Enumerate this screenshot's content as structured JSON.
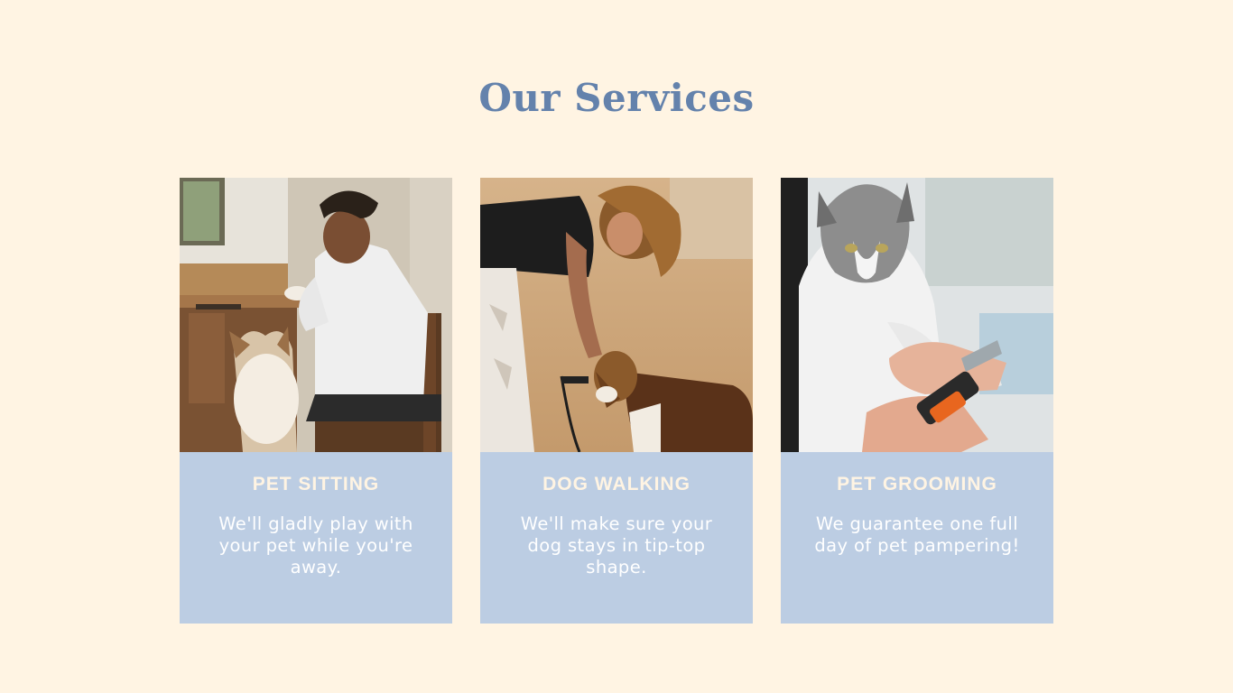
{
  "page": {
    "title": "Our Services"
  },
  "colors": {
    "background": "#fff4e3",
    "title": "#6482ac",
    "card": "#bccde3",
    "card_title": "#fff4e3",
    "card_text": "#ffffff"
  },
  "services": [
    {
      "title": "PET SITTING",
      "description": "We'll gladly play with your pet while you're away.",
      "image": "man-with-husky-photo"
    },
    {
      "title": "DOG WALKING",
      "description": "We'll make sure your dog stays in tip-top shape.",
      "image": "woman-with-beagle-photo"
    },
    {
      "title": "PET GROOMING",
      "description": "We guarantee one full day of pet pampering!",
      "image": "cat-nail-trim-photo"
    }
  ]
}
